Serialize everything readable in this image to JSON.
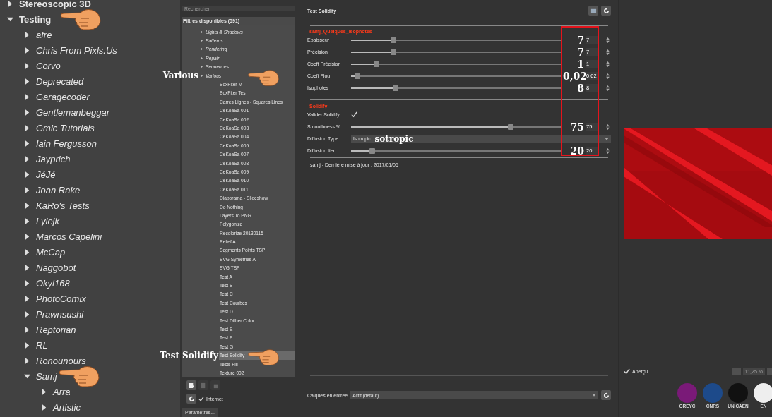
{
  "left_tree": [
    {
      "label": "Stereoscopic 3D",
      "expanded": false
    },
    {
      "label": "Testing",
      "expanded": true,
      "pointer": true,
      "children": [
        {
          "label": "afre",
          "expanded": false
        },
        {
          "label": "Chris From Pixls.Us",
          "expanded": false
        },
        {
          "label": "Corvo",
          "expanded": false
        },
        {
          "label": "Deprecated",
          "expanded": false
        },
        {
          "label": "Garagecoder",
          "expanded": false
        },
        {
          "label": "Gentlemanbeggar",
          "expanded": false
        },
        {
          "label": "Gmic Tutorials",
          "expanded": false
        },
        {
          "label": "Iain Fergusson",
          "expanded": false
        },
        {
          "label": "Jayprich",
          "expanded": false
        },
        {
          "label": "JéJé",
          "expanded": false
        },
        {
          "label": "Joan Rake",
          "expanded": false
        },
        {
          "label": "KaRo's Tests",
          "expanded": false
        },
        {
          "label": "Lylejk",
          "expanded": false
        },
        {
          "label": "Marcos Capelini",
          "expanded": false
        },
        {
          "label": "McCap",
          "expanded": false
        },
        {
          "label": "Naggobot",
          "expanded": false
        },
        {
          "label": "Okyl168",
          "expanded": false
        },
        {
          "label": "PhotoComix",
          "expanded": false
        },
        {
          "label": "Prawnsushi",
          "expanded": false
        },
        {
          "label": "Reptorian",
          "expanded": false
        },
        {
          "label": "RL",
          "expanded": false
        },
        {
          "label": "Ronounours",
          "expanded": false
        },
        {
          "label": "Samj",
          "expanded": true,
          "pointer": true,
          "children": [
            {
              "label": "Arra",
              "expanded": false
            },
            {
              "label": "Artistic",
              "expanded": false
            }
          ]
        }
      ]
    }
  ],
  "filters": {
    "search": {
      "placeholder": "Rechercher"
    },
    "header": "Filtres disponibles (591)",
    "items": [
      {
        "label": "Lights & Shadows",
        "expanded": false
      },
      {
        "label": "Patterns",
        "expanded": false
      },
      {
        "label": "Rendering",
        "expanded": false
      },
      {
        "label": "Repair",
        "expanded": false
      },
      {
        "label": "Sequences",
        "expanded": false
      },
      {
        "label": "Various",
        "expanded": true,
        "pointer": true,
        "pointer_label": "Various",
        "children": [
          {
            "label": "BoxFiter M",
            "selected": false
          },
          {
            "label": "BoxFiter Tes",
            "selected": false
          },
          {
            "label": "Carres Lignes - Squares Lines",
            "selected": false
          },
          {
            "label": "CeKoaSa 001",
            "selected": false
          },
          {
            "label": "CeKoaSa 002",
            "selected": false
          },
          {
            "label": "CeKoaSa 003",
            "selected": false
          },
          {
            "label": "CeKoaSa 004",
            "selected": false
          },
          {
            "label": "CeKoaSa 005",
            "selected": false
          },
          {
            "label": "CeKoaSa 007",
            "selected": false
          },
          {
            "label": "CeKoaSa 008",
            "selected": false
          },
          {
            "label": "CeKoaSa 009",
            "selected": false
          },
          {
            "label": "CeKoaSa 010",
            "selected": false
          },
          {
            "label": "CeKoaSa 011",
            "selected": false
          },
          {
            "label": "Diaporama - Slideshow",
            "selected": false
          },
          {
            "label": "Do Nothing",
            "selected": false
          },
          {
            "label": "Layers To PNG",
            "selected": false
          },
          {
            "label": "Polygonize",
            "selected": false
          },
          {
            "label": "Recolorize 20130115",
            "selected": false
          },
          {
            "label": "Relief A",
            "selected": false
          },
          {
            "label": "Segments Points TSP",
            "selected": false
          },
          {
            "label": "SVG Symetries A",
            "selected": false
          },
          {
            "label": "SVG TSP",
            "selected": false
          },
          {
            "label": "Test A",
            "selected": false
          },
          {
            "label": "Test B",
            "selected": false
          },
          {
            "label": "Test C",
            "selected": false
          },
          {
            "label": "Test Courbes",
            "selected": false
          },
          {
            "label": "Test D",
            "selected": false
          },
          {
            "label": "Test Dither Color",
            "selected": false
          },
          {
            "label": "Test E",
            "selected": false
          },
          {
            "label": "Test F",
            "selected": false
          },
          {
            "label": "Test G",
            "selected": false
          },
          {
            "label": "Test Solidify",
            "selected": true,
            "pointer": true,
            "pointer_label": "Test Solidify"
          },
          {
            "label": "Tests Fill",
            "selected": false
          },
          {
            "label": "Texture 002",
            "selected": false
          }
        ]
      }
    ],
    "internet": {
      "label": "Internet",
      "checked": true
    },
    "settings_button": "Paramètres..."
  },
  "filter": {
    "title": "Test Solidify",
    "params": [
      {
        "kind": "section",
        "title": "samj_Quelques_Isophotes"
      },
      {
        "kind": "slider",
        "label": "Épaisseur",
        "level": 0.2,
        "value": "7",
        "annotation": "7"
      },
      {
        "kind": "slider",
        "label": "Précision",
        "level": 0.2,
        "value": "7",
        "annotation": "7"
      },
      {
        "kind": "slider",
        "label": "Coeff Précision",
        "level": 0.12,
        "value": "1",
        "annotation": "1"
      },
      {
        "kind": "slider",
        "label": "Coeff Flou",
        "level": 0.03,
        "value": "0.02",
        "annotation": "0,02"
      },
      {
        "kind": "slider",
        "label": "Isophotes",
        "level": 0.21,
        "value": "8",
        "annotation": "8"
      },
      {
        "kind": "section",
        "title": "Solidify"
      },
      {
        "kind": "checkbox",
        "label": "Valider Solidify",
        "checked": true
      },
      {
        "kind": "slider",
        "label": "Smoothness %",
        "level": 0.76,
        "value": "75",
        "annotation": "75"
      },
      {
        "kind": "dropdown",
        "label": "Diffusion Type",
        "value": "Isotropic",
        "annotation": "sotropic"
      },
      {
        "kind": "slider",
        "label": "Diffusion Iter",
        "level": 0.1,
        "value": "20",
        "annotation": "20"
      }
    ],
    "footer": "samj - Dernière mise à jour : 2017/01/05",
    "layers": {
      "label": "Calques en entrée",
      "value": "Actif (défaut)"
    }
  },
  "preview": {
    "checkbox": {
      "label": "Aperçu",
      "checked": true
    },
    "zoom": "11,25 %",
    "logos": [
      {
        "label": "GREYC"
      },
      {
        "label": "CNRS"
      },
      {
        "label": "UNICAEN"
      },
      {
        "label": "EN"
      }
    ]
  }
}
